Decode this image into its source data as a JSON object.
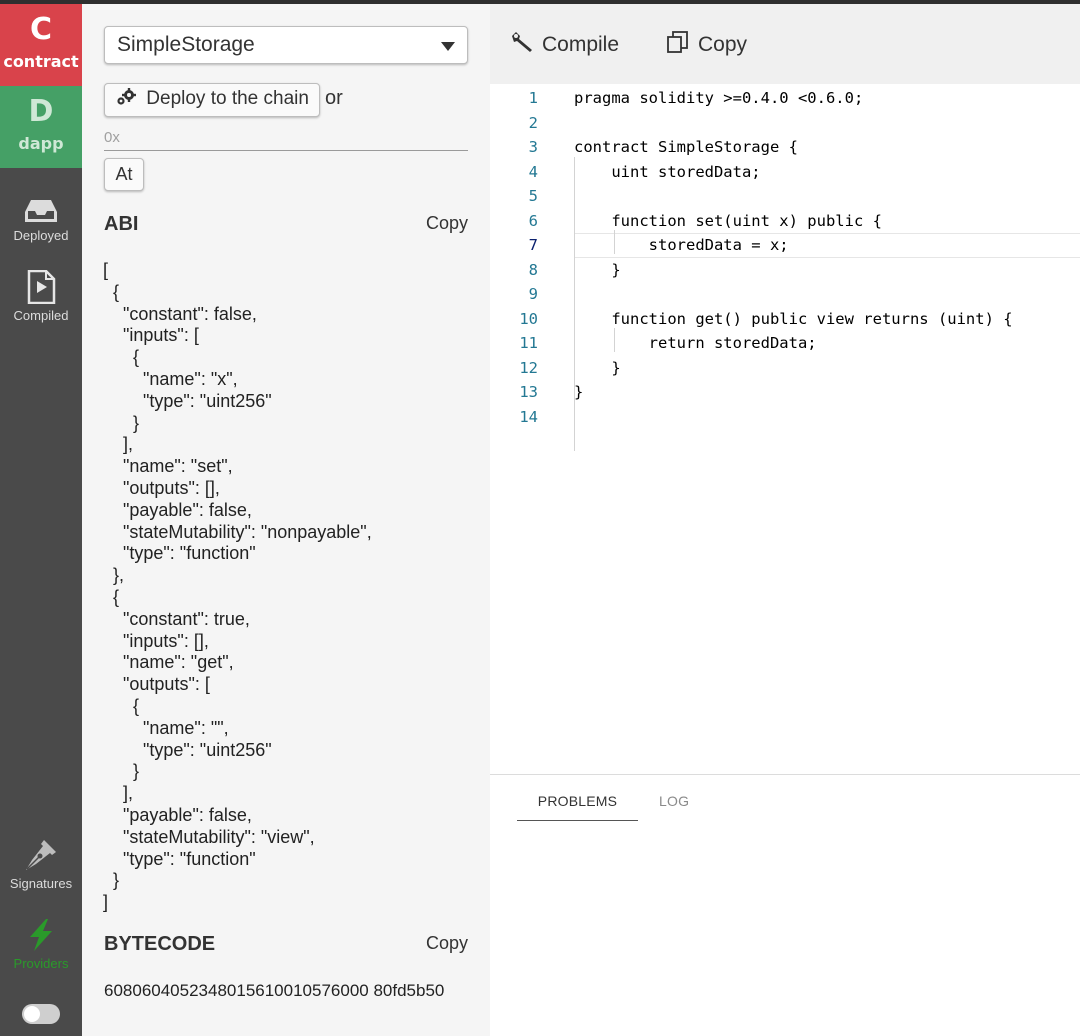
{
  "sidebar": {
    "contract_tab": {
      "letter": "C",
      "label": "contract"
    },
    "dapp_tab": {
      "letter": "D",
      "label": "dapp"
    },
    "deployed_label": "Deployed",
    "compiled_label": "Compiled",
    "signatures_label": "Signatures",
    "providers_label": "Providers",
    "toggle_on": false
  },
  "contract_panel": {
    "selected_contract": "SimpleStorage",
    "deploy_label": "Deploy to the chain",
    "or_text": "or",
    "address_placeholder": "0x",
    "address_value": "",
    "at_label": "At",
    "abi_title": "ABI",
    "abi_copy_label": "Copy",
    "abi_json": "[\n  {\n    \"constant\": false,\n    \"inputs\": [\n      {\n        \"name\": \"x\",\n        \"type\": \"uint256\"\n      }\n    ],\n    \"name\": \"set\",\n    \"outputs\": [],\n    \"payable\": false,\n    \"stateMutability\": \"nonpayable\",\n    \"type\": \"function\"\n  },\n  {\n    \"constant\": true,\n    \"inputs\": [],\n    \"name\": \"get\",\n    \"outputs\": [\n      {\n        \"name\": \"\",\n        \"type\": \"uint256\"\n      }\n    ],\n    \"payable\": false,\n    \"stateMutability\": \"view\",\n    \"type\": \"function\"\n  }\n]",
    "bytecode_title": "BYTECODE",
    "bytecode_copy_label": "Copy",
    "bytecode_value": "6080604052348015610010576000 80fd5b50"
  },
  "editor": {
    "compile_label": "Compile",
    "copy_label": "Copy",
    "active_line": 7,
    "lines": [
      "pragma solidity >=0.4.0 <0.6.0;",
      "",
      "contract SimpleStorage {",
      "    uint storedData;",
      "",
      "    function set(uint x) public {",
      "        storedData = x;",
      "    }",
      "",
      "    function get() public view returns (uint) {",
      "        return storedData;",
      "    }",
      "}",
      ""
    ]
  },
  "bottom_panel": {
    "tabs": [
      "PROBLEMS",
      "LOG"
    ],
    "active_tab": "PROBLEMS"
  },
  "colors": {
    "contract_tab": "#d9434b",
    "dapp_tab": "#45a066",
    "rail": "#4a4a4a",
    "providers_icon": "#2a9a2a",
    "line_number": "#237893"
  },
  "icons": {
    "compile": "wrench-icon",
    "copy": "copy-icon",
    "deploy": "gears-icon",
    "deployed": "inbox-tray-icon",
    "compiled": "play-file-icon",
    "signatures": "fountain-pen-icon",
    "providers": "lightning-bolt-icon"
  }
}
